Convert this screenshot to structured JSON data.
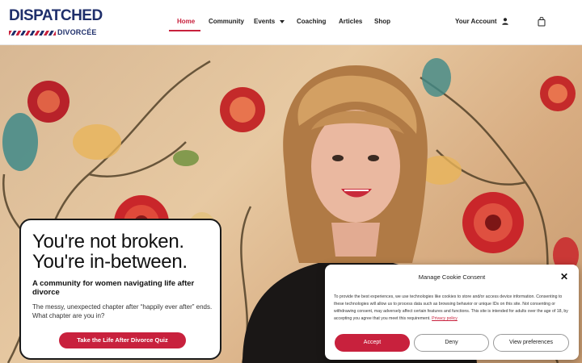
{
  "logo": {
    "main": "DISPATCHED",
    "sub": "DIVORCÉE"
  },
  "nav": {
    "items": [
      {
        "label": "Home"
      },
      {
        "label": "Community"
      },
      {
        "label": "Events"
      },
      {
        "label": "Coaching"
      },
      {
        "label": "Articles"
      },
      {
        "label": "Shop"
      }
    ],
    "account_label": "Your Account"
  },
  "icons": {
    "user": "user-icon",
    "cart": "shopping-bag-icon",
    "caret": "chevron-down-icon",
    "close": "close-icon"
  },
  "colors": {
    "accent": "#c8213d",
    "brand_navy": "#1f2f6b"
  },
  "hero": {
    "title_line1": "You're not broken.",
    "title_line2": "You're in-between.",
    "subtitle": "A community for women navigating life after divorce",
    "body": "The messy, unexpected chapter after “happily ever after” ends. What chapter are you in?",
    "cta_label": "Take the Life After Divorce Quiz"
  },
  "cookie": {
    "title": "Manage Cookie Consent",
    "text": "To provide the best experiences, we use technologies like cookies to store and/or access device information. Consenting to these technologies will allow us to process data such as browsing behavior or unique IDs on this site. Not consenting or withdrawing consent, may adversely affect certain features and functions. This site is intended for adults over the age of 18, by accepting you agree that you meet this requirement.",
    "link_label": "Privacy policy",
    "accept_label": "Accept",
    "deny_label": "Deny",
    "preferences_label": "View preferences"
  }
}
